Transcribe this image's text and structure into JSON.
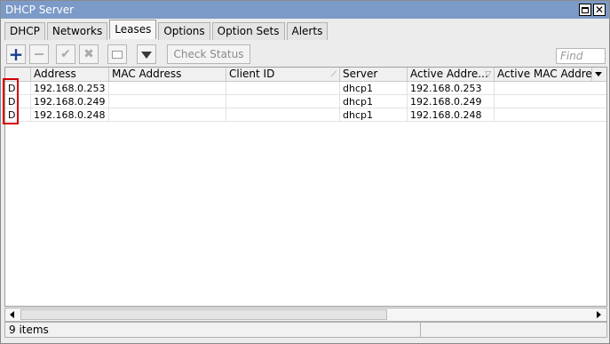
{
  "window": {
    "title": "DHCP Server"
  },
  "tabs": [
    {
      "label": "DHCP"
    },
    {
      "label": "Networks"
    },
    {
      "label": "Leases",
      "active": true
    },
    {
      "label": "Options"
    },
    {
      "label": "Option Sets"
    },
    {
      "label": "Alerts"
    }
  ],
  "toolbar": {
    "add_icon": "plus-icon",
    "remove_icon": "minus-icon",
    "enable_icon": "check-icon",
    "disable_icon": "x-icon",
    "comment_icon": "comment-icon",
    "filter_icon": "filter-icon",
    "check_status_label": "Check Status",
    "find_placeholder": "Find"
  },
  "table": {
    "columns": [
      "",
      "Address",
      "MAC Address",
      "Client ID",
      "Server",
      "Active Addre...",
      "Active MAC Address"
    ],
    "rows": [
      {
        "flag": "D",
        "address": "192.168.0.253",
        "mac": "",
        "client_id": "",
        "server": "dhcp1",
        "active_address": "192.168.0.253",
        "active_mac": ""
      },
      {
        "flag": "D",
        "address": "192.168.0.249",
        "mac": "",
        "client_id": "",
        "server": "dhcp1",
        "active_address": "192.168.0.249",
        "active_mac": ""
      },
      {
        "flag": "D",
        "address": "192.168.0.248",
        "mac": "",
        "client_id": "",
        "server": "dhcp1",
        "active_address": "192.168.0.248",
        "active_mac": ""
      }
    ]
  },
  "status": {
    "items_count": "9 items"
  },
  "colors": {
    "titlebar": "#7b9ac7",
    "highlight": "#d40000",
    "add_icon": "#1d3e8c"
  }
}
